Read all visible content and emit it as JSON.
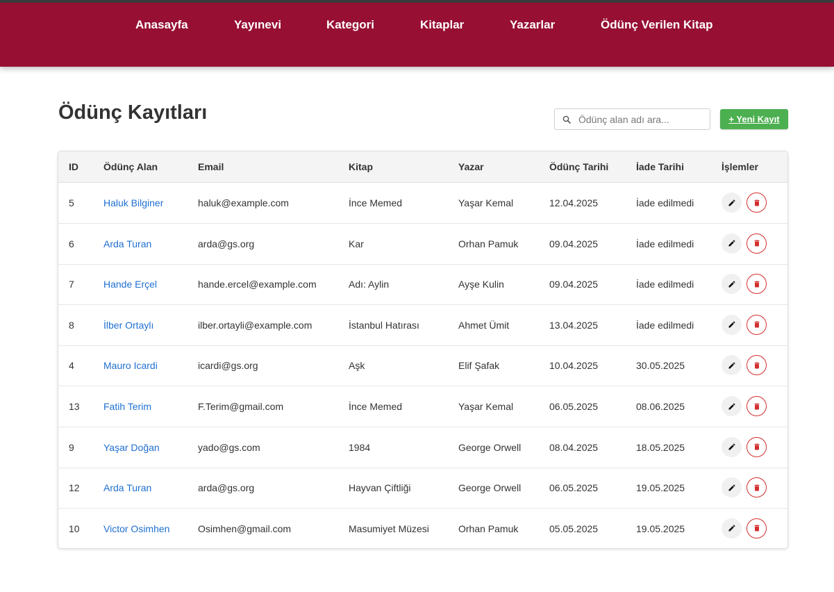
{
  "nav": {
    "items": [
      {
        "label": "Anasayfa"
      },
      {
        "label": "Yayınevi"
      },
      {
        "label": "Kategori"
      },
      {
        "label": "Kitaplar"
      },
      {
        "label": "Yazarlar"
      },
      {
        "label": "Ödünç Verilen Kitap"
      }
    ]
  },
  "page": {
    "title": "Ödünç Kayıtları"
  },
  "search": {
    "placeholder": "Ödünç alan adı ara...",
    "value": ""
  },
  "actions": {
    "new_label": "+ Yeni Kayıt"
  },
  "table": {
    "headers": [
      "ID",
      "Ödünç Alan",
      "Email",
      "Kitap",
      "Yazar",
      "Ödünç Tarihi",
      "İade Tarihi",
      "İşlemler"
    ],
    "rows": [
      {
        "id": "5",
        "name": "Haluk Bilginer",
        "email": "haluk@example.com",
        "book": "İnce Memed",
        "author": "Yaşar Kemal",
        "borrow_date": "12.04.2025",
        "return_date": "İade edilmedi"
      },
      {
        "id": "6",
        "name": "Arda Turan",
        "email": "arda@gs.org",
        "book": "Kar",
        "author": "Orhan Pamuk",
        "borrow_date": "09.04.2025",
        "return_date": "İade edilmedi"
      },
      {
        "id": "7",
        "name": "Hande Erçel",
        "email": "hande.ercel@example.com",
        "book": "Adı: Aylin",
        "author": "Ayşe Kulin",
        "borrow_date": "09.04.2025",
        "return_date": "İade edilmedi"
      },
      {
        "id": "8",
        "name": "İlber Ortaylı",
        "email": "ilber.ortayli@example.com",
        "book": "İstanbul Hatırası",
        "author": "Ahmet Ümit",
        "borrow_date": "13.04.2025",
        "return_date": "İade edilmedi"
      },
      {
        "id": "4",
        "name": "Mauro Icardi",
        "email": "icardi@gs.org",
        "book": "Aşk",
        "author": "Elif Şafak",
        "borrow_date": "10.04.2025",
        "return_date": "30.05.2025"
      },
      {
        "id": "13",
        "name": "Fatih Terim",
        "email": "F.Terim@gmail.com",
        "book": "İnce Memed",
        "author": "Yaşar Kemal",
        "borrow_date": "06.05.2025",
        "return_date": "08.06.2025"
      },
      {
        "id": "9",
        "name": "Yaşar Doğan",
        "email": "yado@gs.com",
        "book": "1984",
        "author": "George Orwell",
        "borrow_date": "08.04.2025",
        "return_date": "18.05.2025"
      },
      {
        "id": "12",
        "name": "Arda Turan",
        "email": "arda@gs.org",
        "book": "Hayvan Çiftliği",
        "author": "George Orwell",
        "borrow_date": "06.05.2025",
        "return_date": "19.05.2025"
      },
      {
        "id": "10",
        "name": "Victor Osimhen",
        "email": "Osimhen@gmail.com",
        "book": "Masumiyet Müzesi",
        "author": "Orhan Pamuk",
        "borrow_date": "05.05.2025",
        "return_date": "19.05.2025"
      }
    ]
  },
  "icons": {
    "search": "search-icon",
    "edit": "pencil-icon",
    "delete": "trash-icon"
  },
  "colors": {
    "nav_bg": "#970f33",
    "primary_button": "#4caf50",
    "link": "#1f6fd1",
    "danger": "#d32f2f"
  }
}
